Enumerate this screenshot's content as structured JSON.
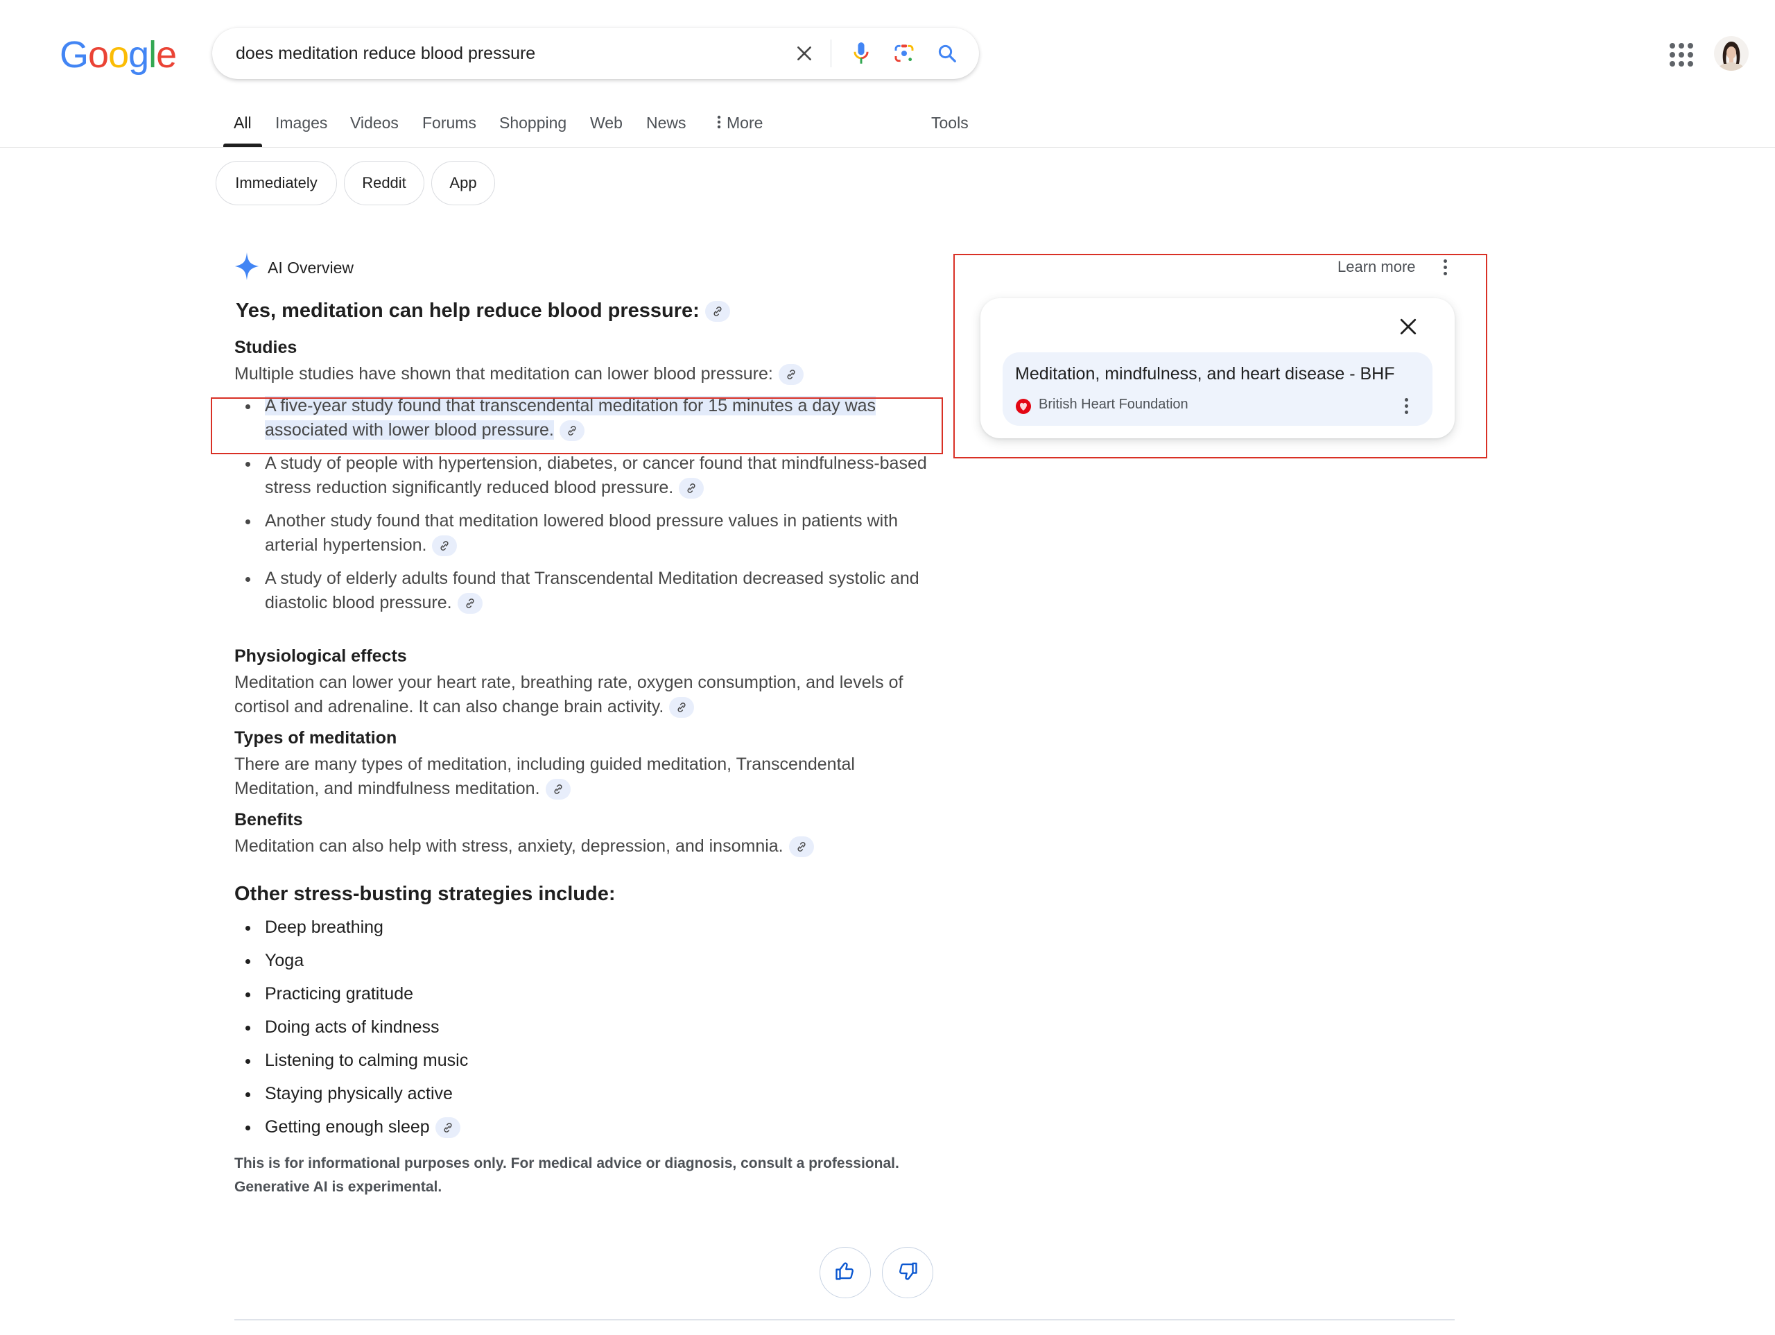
{
  "header": {
    "logo_letters": [
      {
        "ch": "G",
        "color": "#4285F4"
      },
      {
        "ch": "o",
        "color": "#EA4335"
      },
      {
        "ch": "o",
        "color": "#FBBC05"
      },
      {
        "ch": "g",
        "color": "#4285F4"
      },
      {
        "ch": "l",
        "color": "#34A853"
      },
      {
        "ch": "e",
        "color": "#EA4335"
      }
    ],
    "search_query": "does meditation reduce blood pressure",
    "icons": [
      "clear-icon",
      "microphone-icon",
      "google-lens-icon",
      "search-icon",
      "apps-grid-icon",
      "avatar"
    ]
  },
  "tabs": {
    "items": [
      {
        "label": "All",
        "active": true
      },
      {
        "label": "Images"
      },
      {
        "label": "Videos"
      },
      {
        "label": "Forums"
      },
      {
        "label": "Shopping"
      },
      {
        "label": "Web"
      },
      {
        "label": "News"
      },
      {
        "label": "More",
        "icon": "vertical-dots-icon"
      }
    ],
    "tools_label": "Tools"
  },
  "chips": [
    "Immediately",
    "Reddit",
    "App"
  ],
  "ai_overview": {
    "label": "AI Overview",
    "title": "Yes, meditation can help reduce blood pressure:",
    "studies": {
      "heading": "Studies",
      "intro": "Multiple studies have shown that meditation can lower blood pressure:",
      "bullets": [
        "A five-year study found that transcendental meditation for 15 minutes a day was associated with lower blood pressure.",
        "A study of people with hypertension, diabetes, or cancer found that mindfulness-based stress reduction significantly reduced blood pressure.",
        "Another study found that meditation lowered blood pressure values in patients with arterial hypertension.",
        "A study of elderly adults found that Transcendental Meditation decreased systolic and diastolic blood pressure."
      ],
      "highlighted_index": 0
    },
    "sections": [
      {
        "heading": "Physiological effects",
        "text": "Meditation can lower your heart rate, breathing rate, oxygen consumption, and levels of cortisol and adrenaline. It can also change brain activity."
      },
      {
        "heading": "Types of meditation",
        "text": "There are many types of meditation, including guided meditation, Transcendental Meditation, and mindfulness meditation."
      },
      {
        "heading": "Benefits",
        "text": "Meditation can also help with stress, anxiety, depression, and insomnia."
      }
    ],
    "other": {
      "heading": "Other stress-busting strategies include:",
      "items": [
        "Deep breathing",
        "Yoga",
        "Practicing gratitude",
        "Doing acts of kindness",
        "Listening to calming music",
        "Staying physically active",
        "Getting enough sleep"
      ]
    },
    "disclaimer_line1": "This is for informational purposes only. For medical advice or diagnosis, consult a professional.",
    "disclaimer_line2": "Generative AI is experimental.",
    "feedback": [
      "thumbs-up-icon",
      "thumbs-down-icon"
    ]
  },
  "side_panel": {
    "learn_more": "Learn more",
    "source": {
      "title": "Meditation, mindfulness, and heart disease - BHF",
      "site": "British Heart Foundation",
      "favicon_color": "#E30613"
    }
  },
  "colors": {
    "annotation_box": "#d93025",
    "highlight": "#e3ebfa",
    "citation_bg": "#e8eefb",
    "ai_sparkle": "#4285F4"
  }
}
